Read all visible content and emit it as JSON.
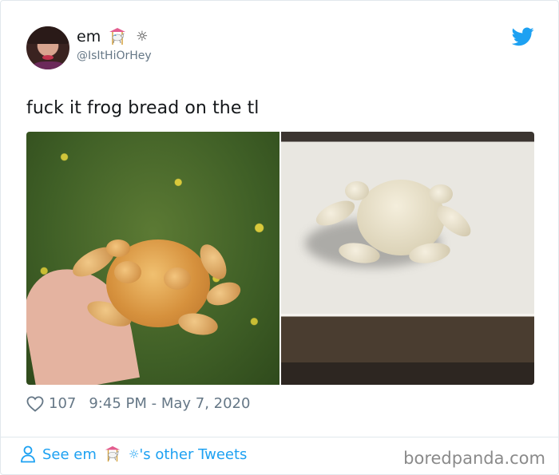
{
  "tweet": {
    "display_name": "em",
    "display_name_emoji": "carousel-horse-emoji",
    "display_name_symbol": "☼",
    "handle": "@IsItHiOrHey",
    "text": "fuck it frog bread on the tl",
    "likes": "107",
    "timestamp": "9:45 PM - May 7, 2020",
    "brand_color": "#1da1f2"
  },
  "footer": {
    "see_prefix": "See em",
    "symbol": "☼",
    "see_suffix": "'s other Tweets"
  },
  "watermark": "boredpanda.com",
  "icons": {
    "logo": "twitter-bird-icon",
    "like": "heart-icon",
    "profile": "user-icon"
  }
}
